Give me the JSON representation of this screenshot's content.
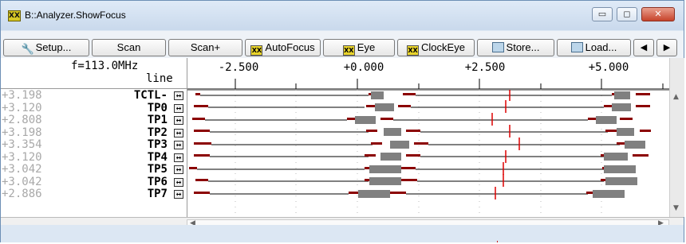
{
  "window": {
    "title": "B::Analyzer.ShowFocus",
    "controls": {
      "minimize": "▭",
      "maximize": "◻",
      "close": "✕"
    }
  },
  "toolbar": {
    "buttons": [
      {
        "label": "Setup...",
        "icon": "wrench-icon"
      },
      {
        "label": "Scan",
        "icon": ""
      },
      {
        "label": "Scan+",
        "icon": ""
      },
      {
        "label": "AutoFocus",
        "icon": "autofocus-icon"
      },
      {
        "label": "Eye",
        "icon": "eye-icon"
      },
      {
        "label": "ClockEye",
        "icon": "clockeye-icon"
      },
      {
        "label": "Store...",
        "icon": "disk-store-icon"
      },
      {
        "label": "Load...",
        "icon": "disk-load-icon"
      }
    ],
    "scroll_left": "◀",
    "scroll_right": "▶"
  },
  "header": {
    "frequency": "f=113.0MHz",
    "line_label": "line",
    "ruler_labels": [
      "-2.500",
      "+0.000",
      "+2.500",
      "+5.000"
    ]
  },
  "rows": [
    {
      "value": "+3.198",
      "name": "TCTL-"
    },
    {
      "value": "+3.120",
      "name": "TP0"
    },
    {
      "value": "+2.808",
      "name": "TP1"
    },
    {
      "value": "+3.198",
      "name": "TP2"
    },
    {
      "value": "+3.354",
      "name": "TP3"
    },
    {
      "value": "+3.120",
      "name": "TP4"
    },
    {
      "value": "+3.042",
      "name": "TP5"
    },
    {
      "value": "+3.042",
      "name": "TP6"
    },
    {
      "value": "+2.886",
      "name": "TP7"
    }
  ],
  "colors": {
    "marker": "#cc0000",
    "bar": "#808080",
    "transition": "#8b0000"
  }
}
